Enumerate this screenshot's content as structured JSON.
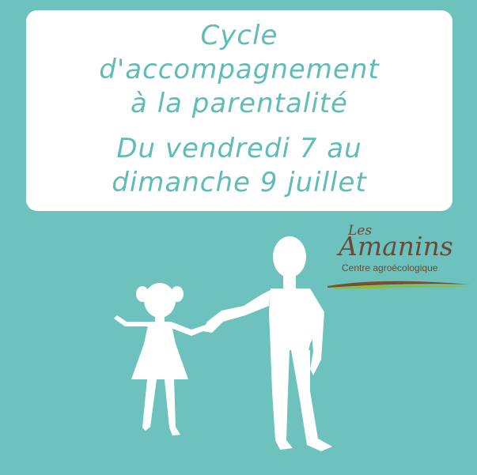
{
  "card": {
    "line1": "Cycle",
    "line2": "d'accompagnement",
    "line3": "à la parentalité",
    "line4": "Du vendredi 7 au",
    "line5": "dimanche 9 juillet"
  },
  "logo": {
    "les": "Les",
    "name": "Amanins",
    "subtitle": "Centre agroécologique"
  },
  "colors": {
    "background": "#6ec2bd",
    "card": "#ffffff",
    "title_text": "#5fbcb6",
    "logo_text": "#6a4a3a",
    "swoosh_brown": "#7a4f2e",
    "swoosh_green": "#8bbd3a",
    "figures": "#ffffff"
  }
}
